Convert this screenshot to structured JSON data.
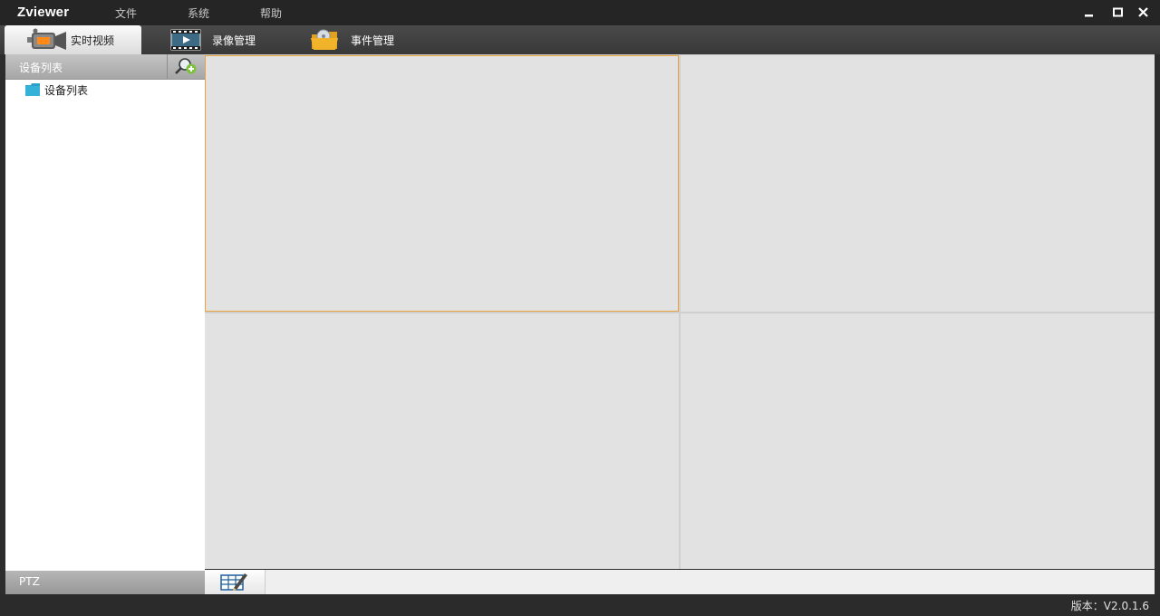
{
  "app": {
    "title": "Zviewer"
  },
  "menu": {
    "items": [
      {
        "label": "文件"
      },
      {
        "label": "系统"
      },
      {
        "label": "帮助"
      }
    ]
  },
  "tabs": [
    {
      "label": "实时视频",
      "icon": "video-camera-icon",
      "active": true
    },
    {
      "label": "录像管理",
      "icon": "film-playback-icon",
      "active": false
    },
    {
      "label": "事件管理",
      "icon": "folder-disc-icon",
      "active": false
    }
  ],
  "sidebar": {
    "header": "设备列表",
    "tree": [
      {
        "label": "设备列表",
        "icon": "folder-icon"
      }
    ],
    "ptz_label": "PTZ"
  },
  "video_grid": {
    "rows": 2,
    "cols": 2,
    "selected_index": 0
  },
  "status": {
    "version": "版本：V2.0.1.6"
  },
  "colors": {
    "selected_border": "#e8a33c",
    "folder": "#2aa0c8",
    "add_plus": "#7cc23a"
  }
}
